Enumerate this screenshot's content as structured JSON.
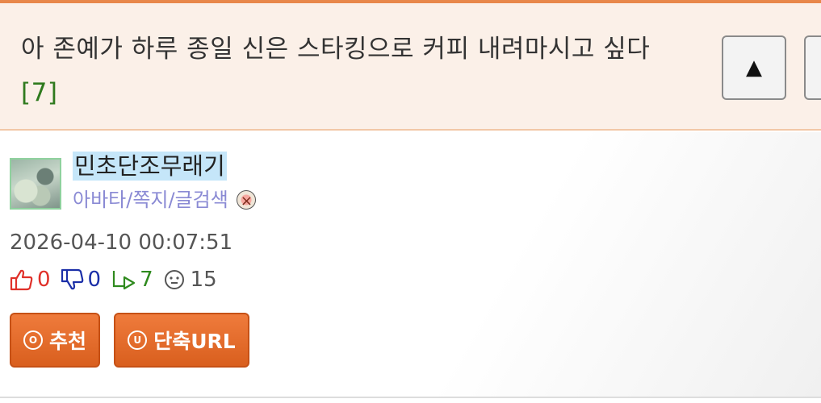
{
  "post": {
    "title": "아 존예가 하루 종일 신은 스타킹으로 커피 내려마시고 싶다",
    "reply_count_label": "[7]"
  },
  "nav": {
    "scroll_up_label": "▲"
  },
  "author": {
    "nickname": "민초단조무래기",
    "links_label": "아바타/쪽지/글검색"
  },
  "meta": {
    "date": "2026-04-10 00:07:51",
    "upvotes": "0",
    "downvotes": "0",
    "replies": "7",
    "views": "15"
  },
  "actions": {
    "recommend_icon": "ⓞ",
    "recommend_label": "추천",
    "shorturl_icon": "ⓤ",
    "shorturl_label": "단축URL"
  },
  "colors": {
    "accent": "#e8874a",
    "upvote": "#e0312a",
    "downvote": "#1b2fa8",
    "reply": "#2f8a1e"
  }
}
